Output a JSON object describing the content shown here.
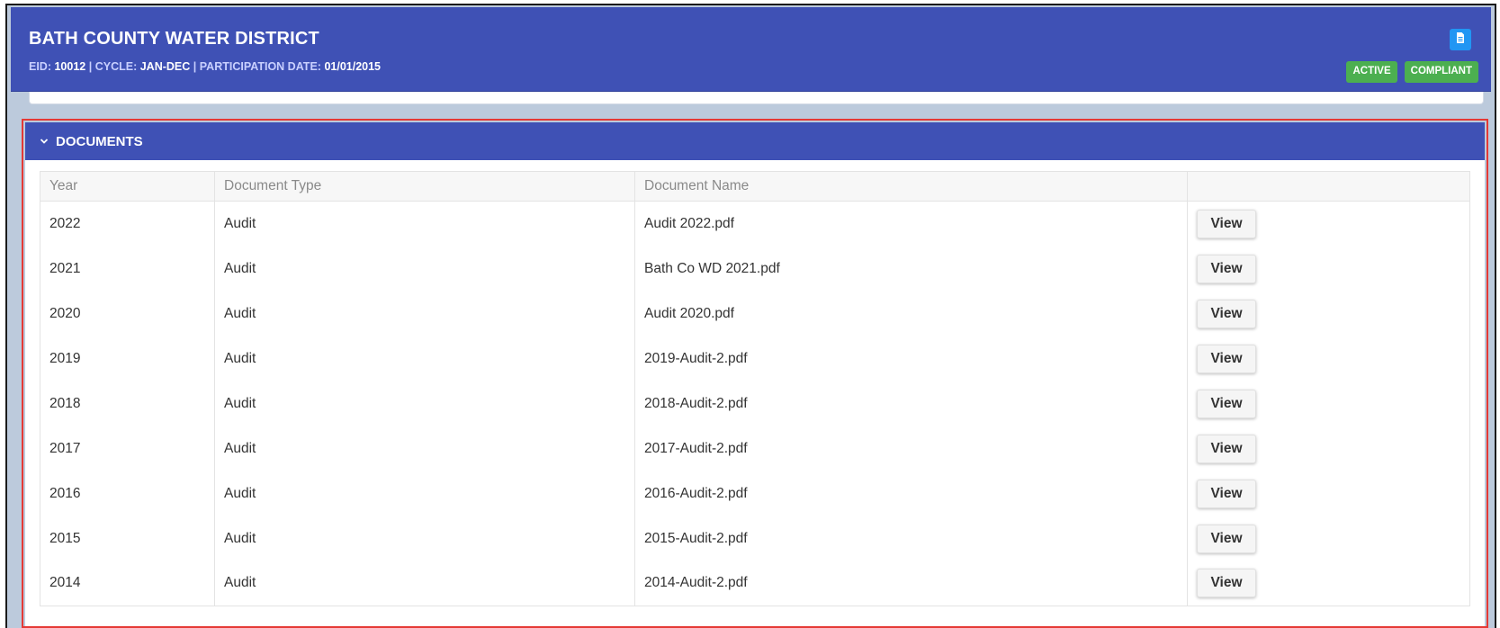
{
  "header": {
    "title": "BATH COUNTY WATER DISTRICT",
    "eid_label": "EID:",
    "eid_value": "10012",
    "separator": "|",
    "cycle_label": "CYCLE:",
    "cycle_value": "JAN-DEC",
    "participation_label": "PARTICIPATION DATE:",
    "participation_value": "01/01/2015",
    "doc_icon": "document-icon",
    "badges": [
      "ACTIVE",
      "COMPLIANT"
    ]
  },
  "documents": {
    "title": "DOCUMENTS",
    "columns": [
      "Year",
      "Document Type",
      "Document Name",
      ""
    ],
    "view_label": "View",
    "rows": [
      {
        "year": "2022",
        "type": "Audit",
        "name": "Audit 2022.pdf"
      },
      {
        "year": "2021",
        "type": "Audit",
        "name": "Bath Co WD 2021.pdf"
      },
      {
        "year": "2020",
        "type": "Audit",
        "name": "Audit 2020.pdf"
      },
      {
        "year": "2019",
        "type": "Audit",
        "name": "2019-Audit-2.pdf"
      },
      {
        "year": "2018",
        "type": "Audit",
        "name": "2018-Audit-2.pdf"
      },
      {
        "year": "2017",
        "type": "Audit",
        "name": "2017-Audit-2.pdf"
      },
      {
        "year": "2016",
        "type": "Audit",
        "name": "2016-Audit-2.pdf"
      },
      {
        "year": "2015",
        "type": "Audit",
        "name": "2015-Audit-2.pdf"
      },
      {
        "year": "2014",
        "type": "Audit",
        "name": "2014-Audit-2.pdf"
      }
    ]
  },
  "colors": {
    "primary": "#3f51b5",
    "badge_green": "#4caf50",
    "icon_blue": "#2196f3",
    "highlight_red": "#e53935"
  }
}
